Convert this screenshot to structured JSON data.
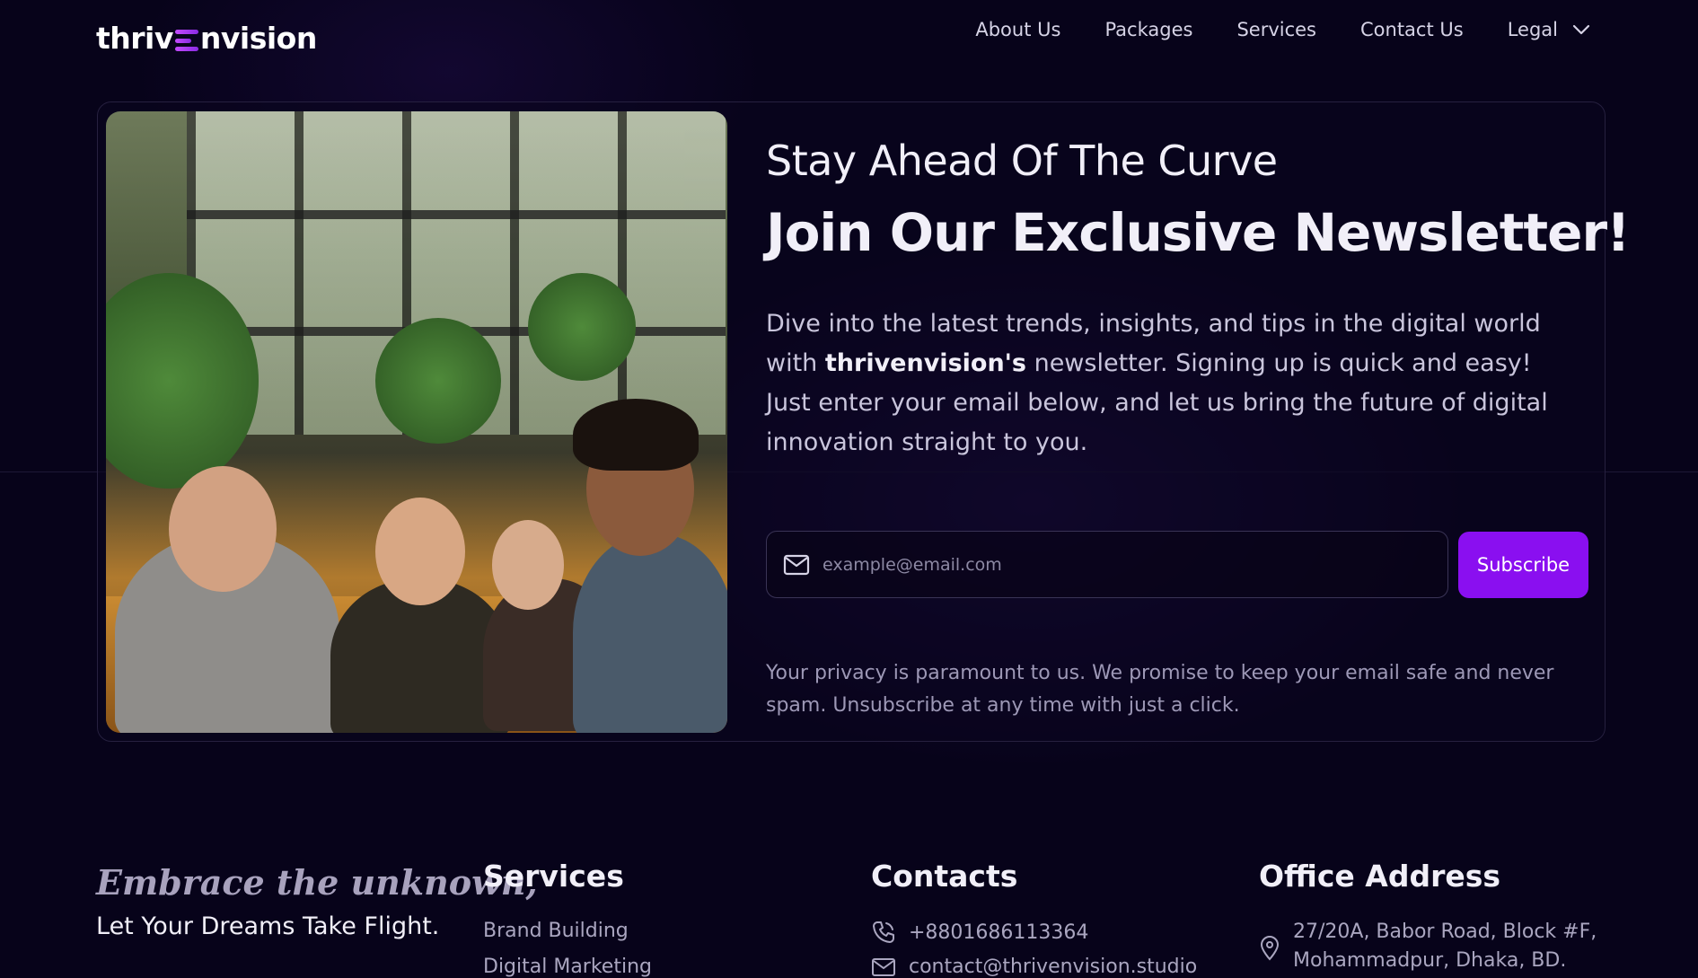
{
  "brand": {
    "logo_part1": "thriv",
    "logo_part2": "nvision"
  },
  "nav": {
    "items": [
      {
        "label": "About Us"
      },
      {
        "label": "Packages"
      },
      {
        "label": "Services"
      },
      {
        "label": "Contact Us"
      }
    ],
    "legal_label": "Legal"
  },
  "newsletter": {
    "kicker": "Stay Ahead Of The Curve",
    "headline": "Join Our Exclusive Newsletter!",
    "description_pre": "Dive into the latest trends, insights, and tips in the digital world with ",
    "description_brand": "thrivenvision's",
    "description_post": " newsletter. Signing up is quick and easy! Just enter your email below, and let us bring the future of digital innovation straight to you.",
    "email_placeholder": "example@email.com",
    "email_value": "",
    "subscribe_label": "Subscribe",
    "privacy": "Your privacy is paramount to us. We promise to keep your email safe and never spam. Unsubscribe at any time with just a click."
  },
  "footer": {
    "tagline_script": "Embrace the unknown,",
    "tagline": "Let Your Dreams Take Flight.",
    "services": {
      "title": "Services",
      "items": [
        "Brand Building",
        "Digital Marketing"
      ]
    },
    "contacts": {
      "title": "Contacts",
      "phone": "+8801686113364",
      "email": "contact@thrivenvision.studio"
    },
    "office": {
      "title": "Office Address",
      "address": "27/20A, Babor Road, Block #F, Mohammadpur, Dhaka, BD."
    }
  },
  "colors": {
    "accent": "#8a0ff0",
    "background": "#07031a"
  }
}
